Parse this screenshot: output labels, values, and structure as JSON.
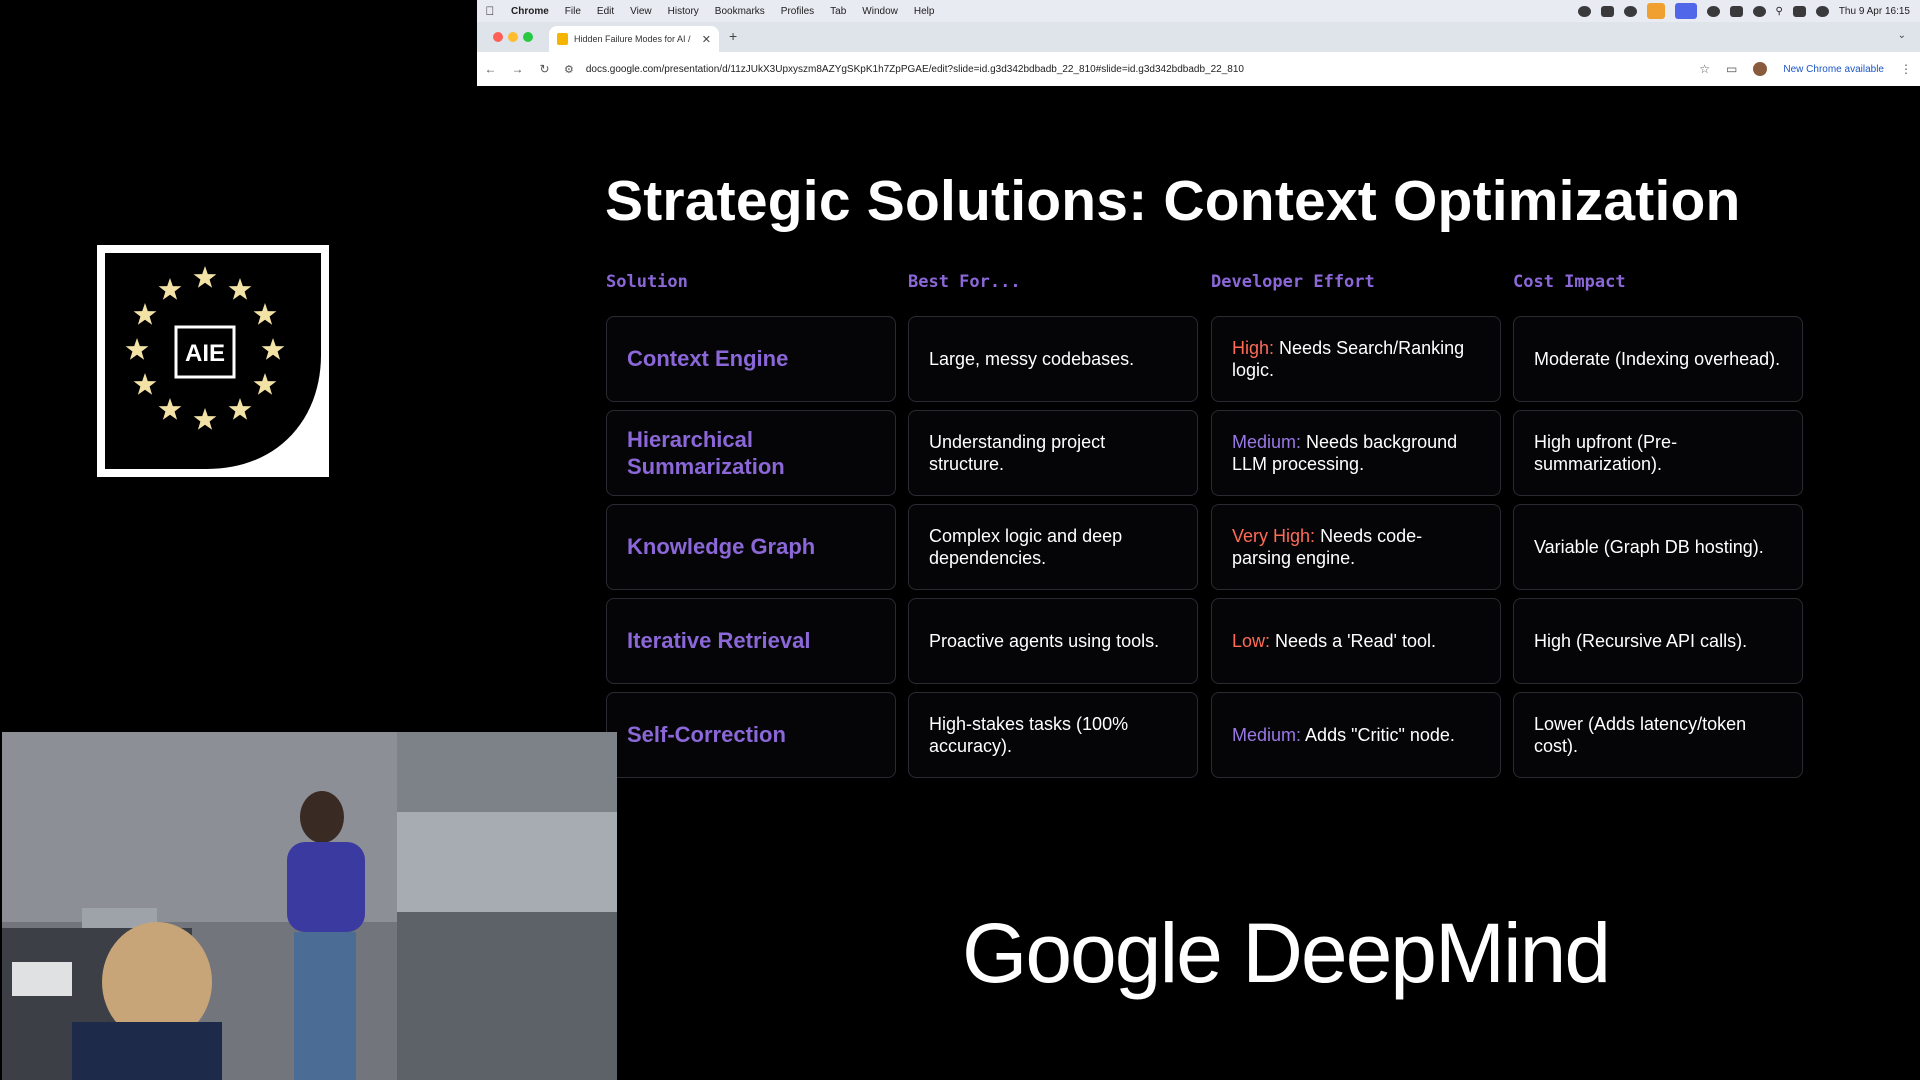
{
  "macos_menubar": {
    "app_name": "Chrome",
    "menus": [
      "File",
      "Edit",
      "View",
      "History",
      "Bookmarks",
      "Profiles",
      "Tab",
      "Window",
      "Help"
    ],
    "clock": "Thu 9 Apr  16:15"
  },
  "browser": {
    "tab_title": "Hidden Failure Modes for AI /",
    "url": "docs.google.com/presentation/d/11zJUkX3Upxyszm8AZYgSKpK1h7ZpPGAE/edit?slide=id.g3d342bdbadb_22_810#slide=id.g3d342bdbadb_22_810",
    "update_label": "New Chrome available"
  },
  "slide": {
    "title": "Strategic Solutions: Context Optimization",
    "headers": [
      "Solution",
      "Best For...",
      "Developer Effort",
      "Cost Impact"
    ],
    "rows": [
      {
        "solution": "Context Engine",
        "best_for": "Large, messy codebases.",
        "effort_level": "High:",
        "effort_text": "Needs Search/Ranking logic.",
        "cost": "Moderate (Indexing overhead)."
      },
      {
        "solution": "Hierarchical Summarization",
        "best_for": "Understanding project structure.",
        "effort_level": "Medium:",
        "effort_text": "Needs background LLM processing.",
        "cost": "High upfront (Pre-summarization)."
      },
      {
        "solution": "Knowledge Graph",
        "best_for": "Complex logic and deep dependencies.",
        "effort_level": "Very High:",
        "effort_text": "Needs code-parsing engine.",
        "cost": "Variable (Graph DB hosting)."
      },
      {
        "solution": "Iterative Retrieval",
        "best_for": "Proactive agents using tools.",
        "effort_level": "Low:",
        "effort_text": "Needs a 'Read' tool.",
        "cost": "High (Recursive API calls)."
      },
      {
        "solution": "Self-Correction",
        "best_for": "High-stakes tasks (100% accuracy).",
        "effort_level": "Medium:",
        "effort_text": "Adds \"Critic\" node.",
        "cost": "Lower (Adds latency/token cost)."
      }
    ],
    "footer_logo": "Google DeepMind",
    "colors": {
      "accent": "#8b67d8",
      "high_effort": "#ff6b57",
      "medium_effort": "#9a78e6"
    }
  },
  "event_logo": {
    "text": "AIE"
  }
}
